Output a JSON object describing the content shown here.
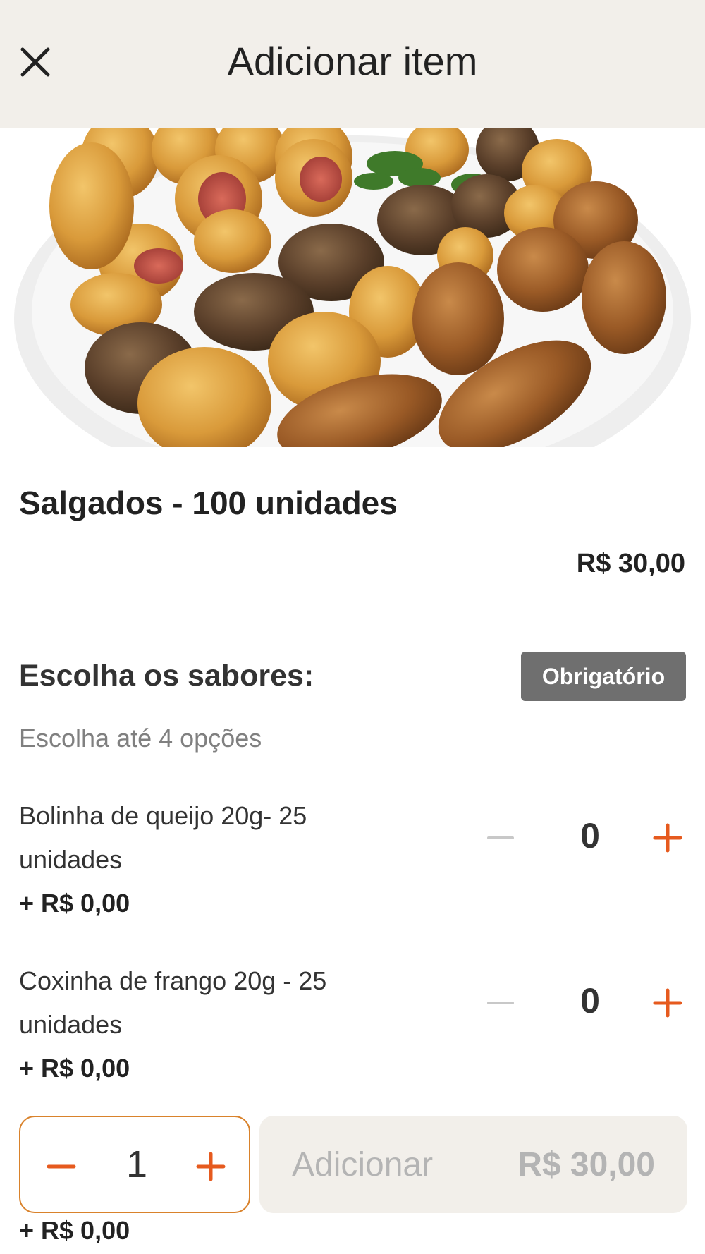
{
  "header": {
    "title": "Adicionar item",
    "close_icon": "close-icon"
  },
  "product": {
    "image": "salgados-platter-photo",
    "title": "Salgados - 100 unidades",
    "price": "R$ 30,00"
  },
  "options_section": {
    "title": "Escolha os sabores:",
    "badge": "Obrigatório",
    "subtitle": "Escolha até 4 opções",
    "items": [
      {
        "name": "Bolinha de queijo 20g- 25 unidades",
        "price": "+ R$ 0,00",
        "count": "0"
      },
      {
        "name": "Coxinha de frango 20g - 25 unidades",
        "price": "+ R$ 0,00",
        "count": "0"
      }
    ],
    "partial_item_price": "+ R$ 0,00"
  },
  "footer": {
    "quantity": "1",
    "add_label": "Adicionar",
    "add_total": "R$ 30,00"
  },
  "colors": {
    "accent": "#e65a1e",
    "header_bg": "#f2efea",
    "badge_bg": "#6f6f6f",
    "qty_border": "#d9822b"
  }
}
